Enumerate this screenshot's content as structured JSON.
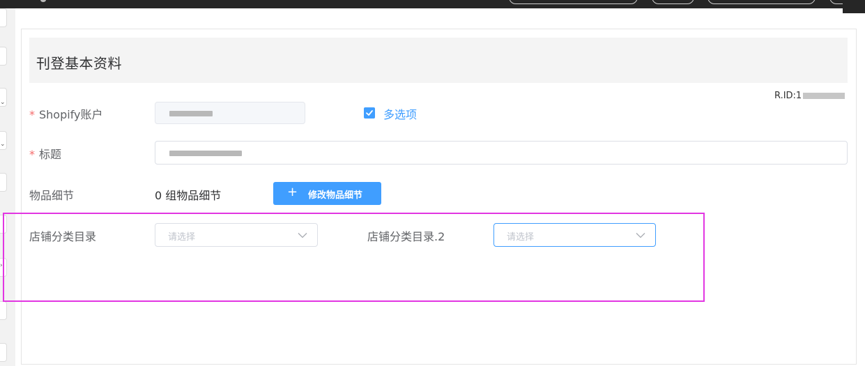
{
  "section": {
    "title": "刊登基本资料"
  },
  "rid": {
    "label": "R.ID:1"
  },
  "form": {
    "shopify_account": {
      "required_mark": "*",
      "label": "Shopify账户"
    },
    "multi_option": {
      "label": "多选项",
      "checked": true
    },
    "title": {
      "required_mark": "*",
      "label": "标题"
    },
    "item_details": {
      "label": "物品细节",
      "count_text": "0 组物品细节",
      "button_label": "修改物品细节"
    },
    "shop_category": {
      "label": "店铺分类目录",
      "placeholder": "请选择"
    },
    "shop_category_2": {
      "label": "店铺分类目录.2",
      "placeholder": "请选择"
    }
  },
  "colors": {
    "primary": "#409eff",
    "required": "#f56c6c",
    "highlight": "#e236e2",
    "topbar": "#262626"
  }
}
